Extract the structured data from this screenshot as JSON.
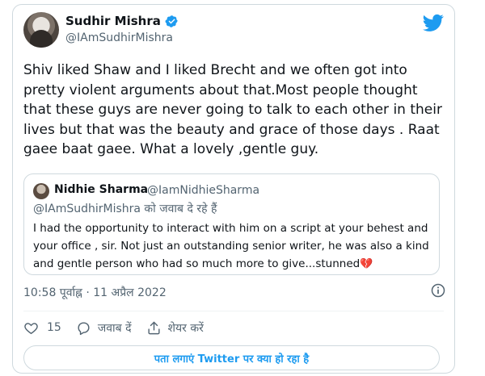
{
  "author": {
    "display_name": "Sudhir Mishra",
    "handle": "@IAmSudhirMishra"
  },
  "tweet": {
    "text": "Shiv liked Shaw and I liked Brecht and we often got into pretty violent arguments about that.Most people thought that these guys are never going to talk to each other in their lives but that was the beauty and grace of those days . Raat gaee baat gaee. What a lovely ,gentle guy.",
    "time": "10:58 पूर्वाह्न",
    "separator": "·",
    "date": "11 अप्रैल 2022"
  },
  "quoted": {
    "display_name": "Nidhie Sharma",
    "handle": "@IamNidhieSharma",
    "reply_to": "@IAmSudhirMishra को जवाब दे रहे हैं",
    "text": "I had the opportunity to interact with him on a script at your behest and your office , sir. Not just an outstanding senior writer, he was also a kind and gentle person who had so much more to give...stunned",
    "emoji": "💔"
  },
  "actions": {
    "like_count": "15",
    "reply_label": "जवाब दें",
    "share_label": "शेयर करें"
  },
  "cta_label": "पता लगाएं Twitter पर क्या हो रहा है",
  "colors": {
    "brand_blue": "#1d9bf0",
    "text_primary": "#0f1419",
    "text_secondary": "#536471",
    "border": "#cfd9de"
  },
  "icons": {
    "verified": "verified-badge-icon",
    "brand": "twitter-bird-icon",
    "info": "info-icon",
    "like": "heart-icon",
    "reply": "reply-bubble-icon",
    "share": "share-upload-icon"
  }
}
